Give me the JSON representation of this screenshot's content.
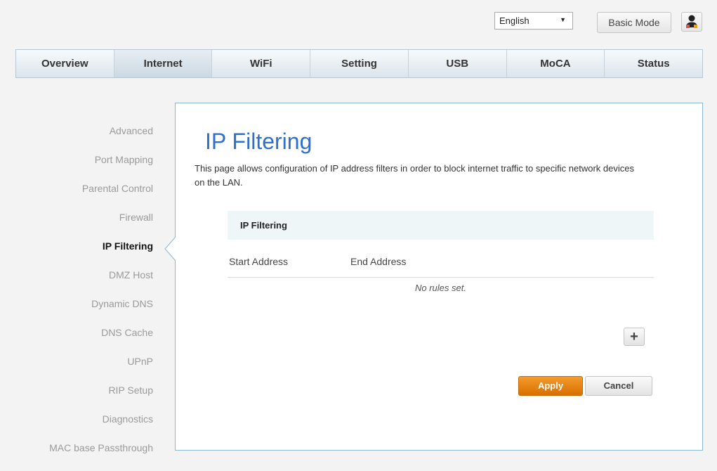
{
  "header": {
    "language_selected": "English",
    "basic_mode_label": "Basic Mode"
  },
  "nav": {
    "tabs": [
      {
        "label": "Overview"
      },
      {
        "label": "Internet",
        "active": true
      },
      {
        "label": "WiFi"
      },
      {
        "label": "Setting"
      },
      {
        "label": "USB"
      },
      {
        "label": "MoCA"
      },
      {
        "label": "Status"
      }
    ]
  },
  "sidebar": {
    "items": [
      {
        "label": "Advanced"
      },
      {
        "label": "Port Mapping"
      },
      {
        "label": "Parental Control"
      },
      {
        "label": "Firewall"
      },
      {
        "label": "IP Filtering",
        "active": true
      },
      {
        "label": "DMZ Host"
      },
      {
        "label": "Dynamic DNS"
      },
      {
        "label": "DNS Cache"
      },
      {
        "label": "UPnP"
      },
      {
        "label": "RIP Setup"
      },
      {
        "label": "Diagnostics"
      },
      {
        "label": "MAC base Passthrough"
      }
    ]
  },
  "main": {
    "title": "IP Filtering",
    "description": "This page allows configuration of IP address filters in order to block internet traffic to specific network devices on the LAN.",
    "section_title": "IP Filtering",
    "columns": [
      "Start Address",
      "End Address"
    ],
    "empty_text": "No rules set.",
    "add_label": "+",
    "apply_label": "Apply",
    "cancel_label": "Cancel"
  },
  "colors": {
    "accent": "#2e6fd1",
    "apply": "#e8820e",
    "panel_border": "#8cb7d4"
  }
}
